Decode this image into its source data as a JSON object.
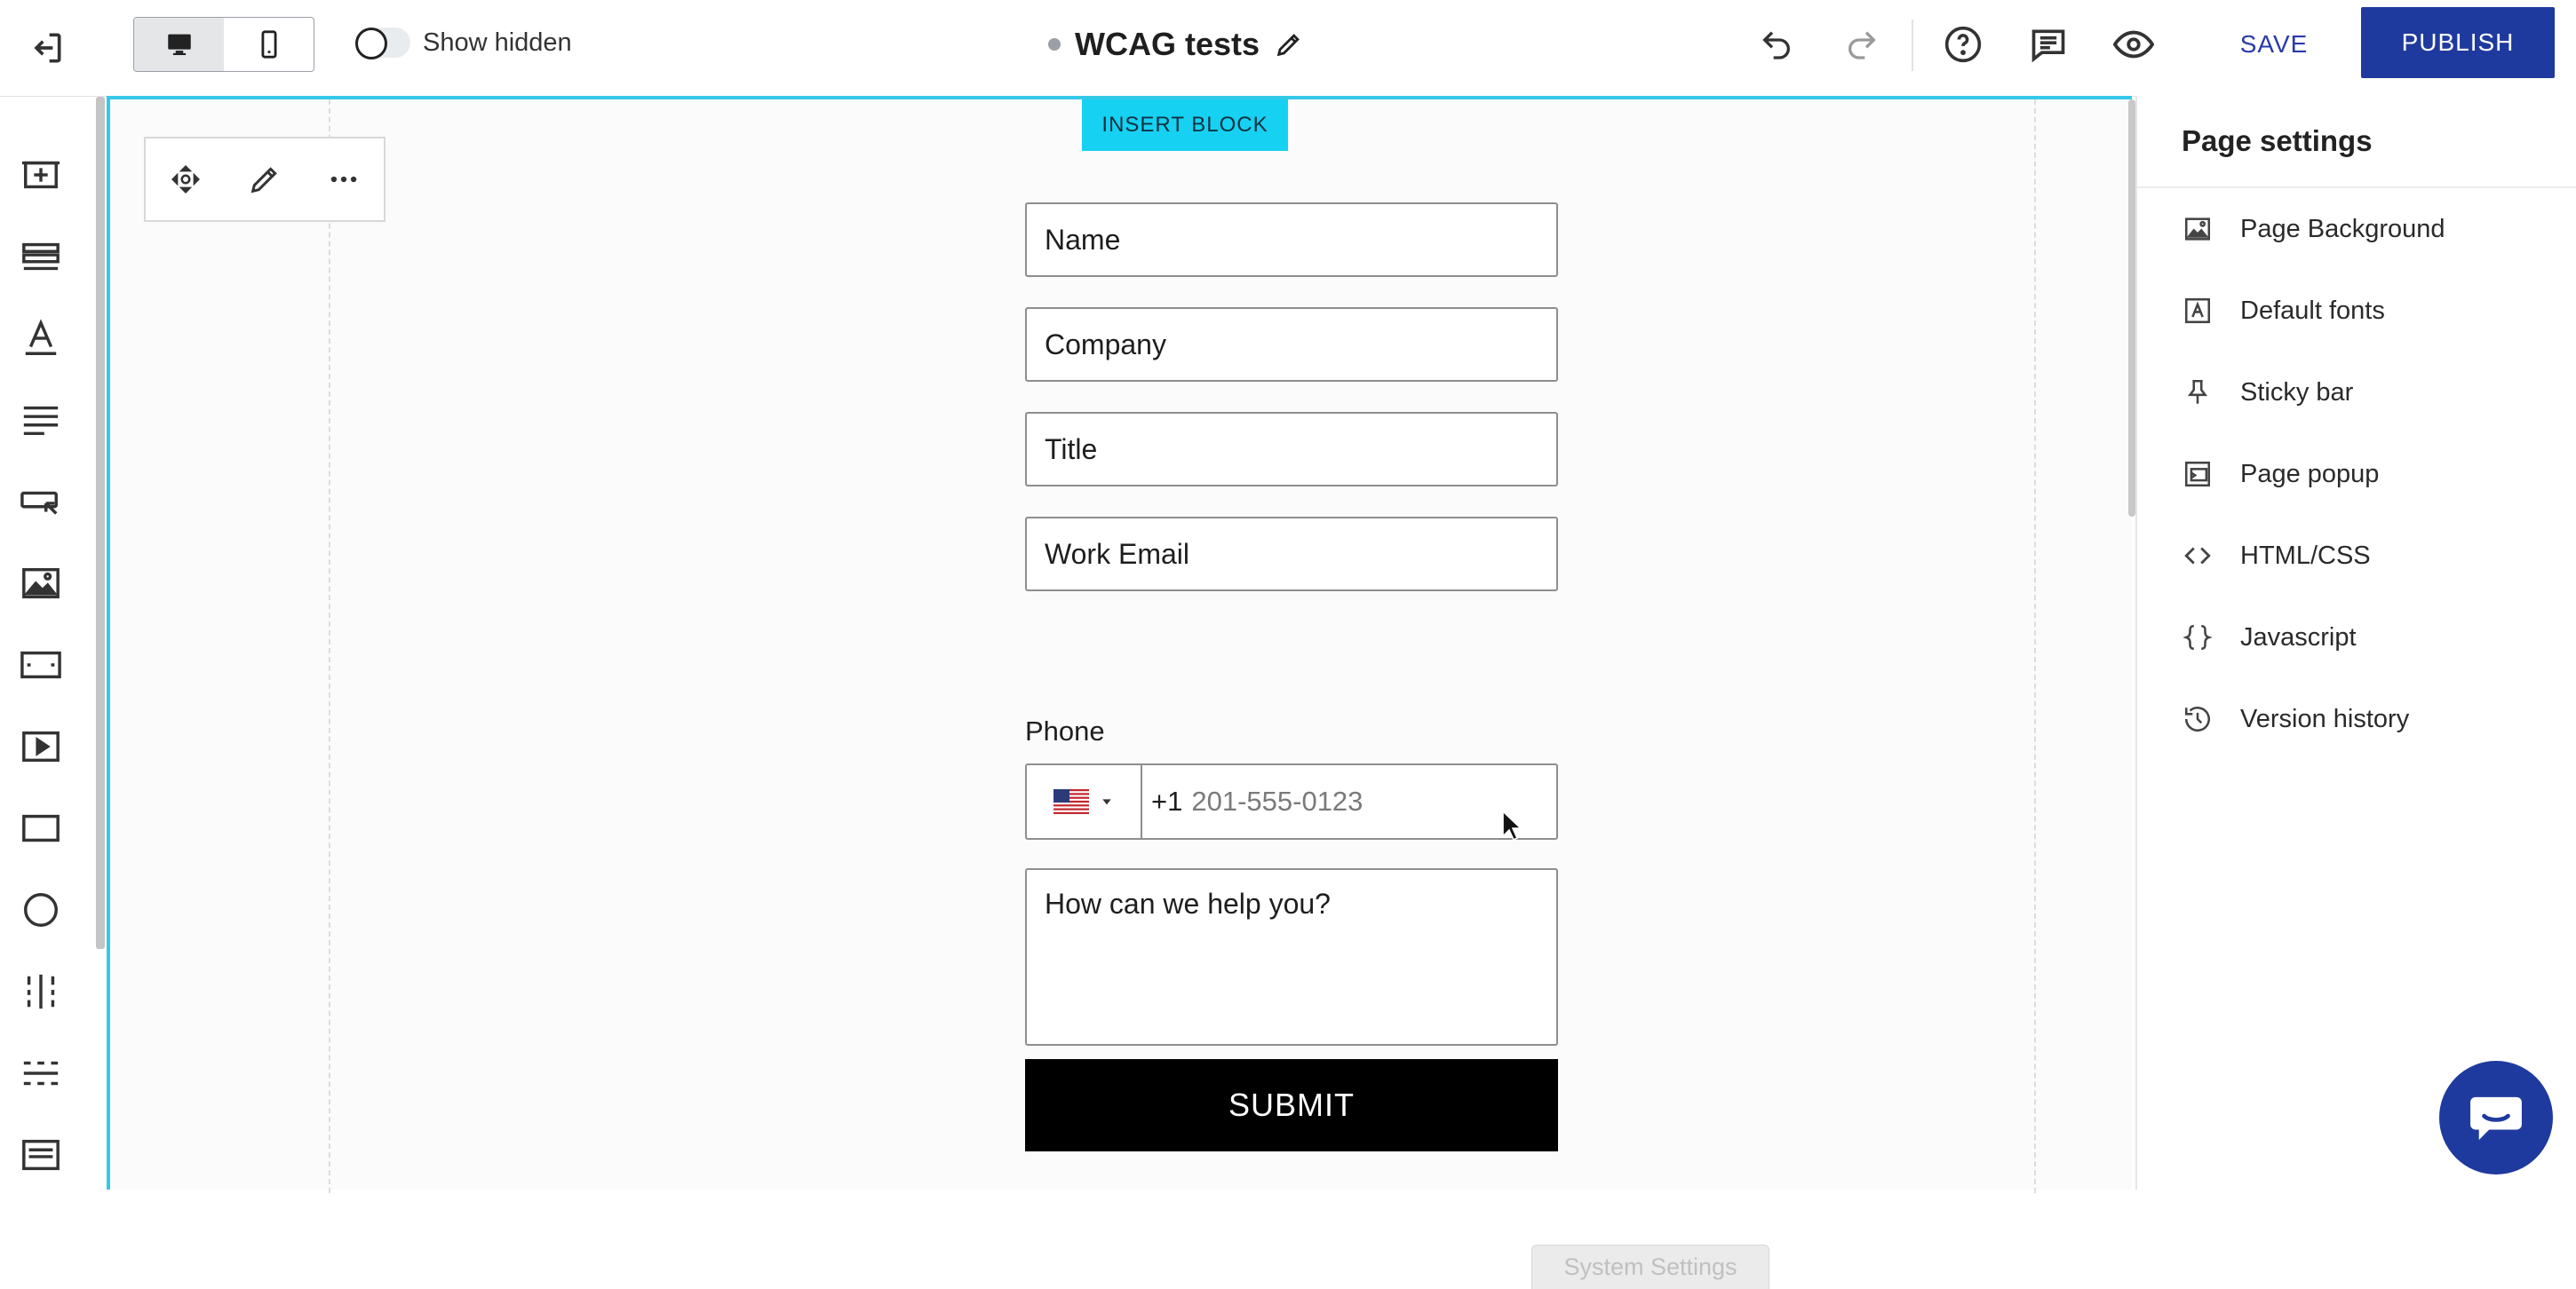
{
  "header": {
    "show_hidden_label": "Show hidden",
    "page_title": "WCAG tests",
    "save_label": "SAVE",
    "publish_label": "PUBLISH",
    "icons": [
      "exit-icon",
      "desktop-icon",
      "mobile-icon",
      "edit-pencil-icon",
      "undo-icon",
      "redo-icon",
      "help-icon",
      "comments-icon",
      "preview-eye-icon"
    ]
  },
  "left_toolbar": {
    "icons": [
      "add-section-icon",
      "rows-icon",
      "text-icon",
      "paragraph-icon",
      "button-icon",
      "image-icon",
      "spacer-icon",
      "video-icon",
      "rectangle-icon",
      "circle-icon",
      "columns-divider-icon",
      "divider-icon",
      "form-icon"
    ]
  },
  "canvas": {
    "insert_block_label": "INSERT BLOCK",
    "block_toolbar_icons": [
      "move-icon",
      "edit-icon",
      "more-icon"
    ],
    "form": {
      "fields": [
        "Name",
        "Company",
        "Title",
        "Work Email"
      ],
      "phone_label": "Phone",
      "phone_prefix": "+1",
      "phone_placeholder": "201-555-0123",
      "country_flag": "us-flag-icon",
      "textarea_placeholder": "How can we help you?",
      "submit_label": "SUBMIT"
    },
    "system_settings_label": "System Settings",
    "accent_color": "#16d1f2"
  },
  "right_panel": {
    "title": "Page settings",
    "items": [
      {
        "label": "Page Background",
        "icon": "image-icon"
      },
      {
        "label": "Default fonts",
        "icon": "font-icon"
      },
      {
        "label": "Sticky bar",
        "icon": "pin-icon"
      },
      {
        "label": "Page popup",
        "icon": "popup-icon"
      },
      {
        "label": "HTML/CSS",
        "icon": "code-icon"
      },
      {
        "label": "Javascript",
        "icon": "braces-icon"
      },
      {
        "label": "Version history",
        "icon": "history-icon"
      }
    ]
  },
  "chat": {
    "icon": "chat-icon"
  },
  "colors": {
    "primary": "#1f3a9e",
    "canvas_outline": "#35c9e8"
  }
}
